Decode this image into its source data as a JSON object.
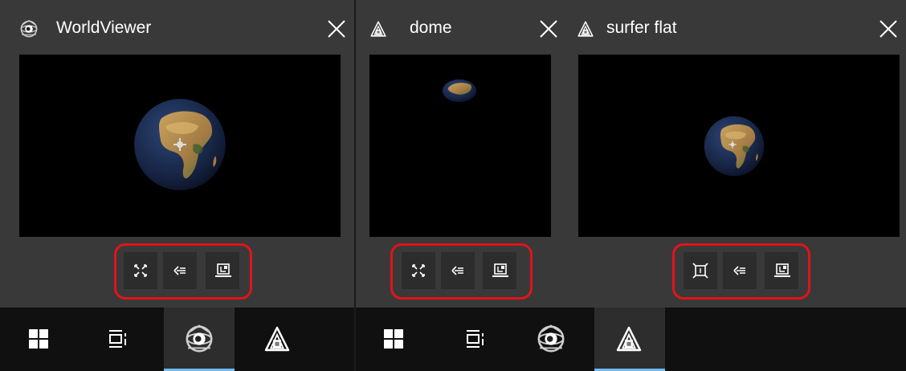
{
  "screens": [
    {
      "windows": [
        {
          "title": "WorldViewer",
          "app_icon": "worldviewer-icon",
          "close_icon": "close-icon",
          "tools": [
            "expand-icon",
            "back-arrow-icon",
            "snapshot-icon"
          ]
        }
      ],
      "taskbar": {
        "items": [
          {
            "icon": "windows-start-icon",
            "active": false
          },
          {
            "icon": "task-view-icon",
            "active": false
          },
          {
            "icon": "worldviewer-icon",
            "active": true
          },
          {
            "icon": "holographic-app-icon",
            "active": false
          }
        ]
      }
    },
    {
      "windows": [
        {
          "title": "dome",
          "app_icon": "holographic-app-icon",
          "close_icon": "close-icon",
          "tools": [
            "expand-icon",
            "back-arrow-icon",
            "snapshot-icon"
          ]
        },
        {
          "title": "surfer flat",
          "app_icon": "holographic-app-icon",
          "close_icon": "close-icon",
          "tools": [
            "contract-icon",
            "back-arrow-icon",
            "snapshot-icon"
          ]
        }
      ],
      "taskbar": {
        "items": [
          {
            "icon": "windows-start-icon",
            "active": false
          },
          {
            "icon": "task-view-icon",
            "active": false
          },
          {
            "icon": "worldviewer-icon",
            "active": false
          },
          {
            "icon": "holographic-app-icon",
            "active": true
          }
        ]
      }
    }
  ],
  "colors": {
    "window_bg": "#393939",
    "viewport_bg": "#000000",
    "highlight_border": "#e0141b",
    "taskbar_bg": "#101010",
    "taskbar_active": "#2d2d2d",
    "active_indicator": "#76b9ed",
    "ocean": "#1b2a4a",
    "land": "#b58a4a"
  }
}
